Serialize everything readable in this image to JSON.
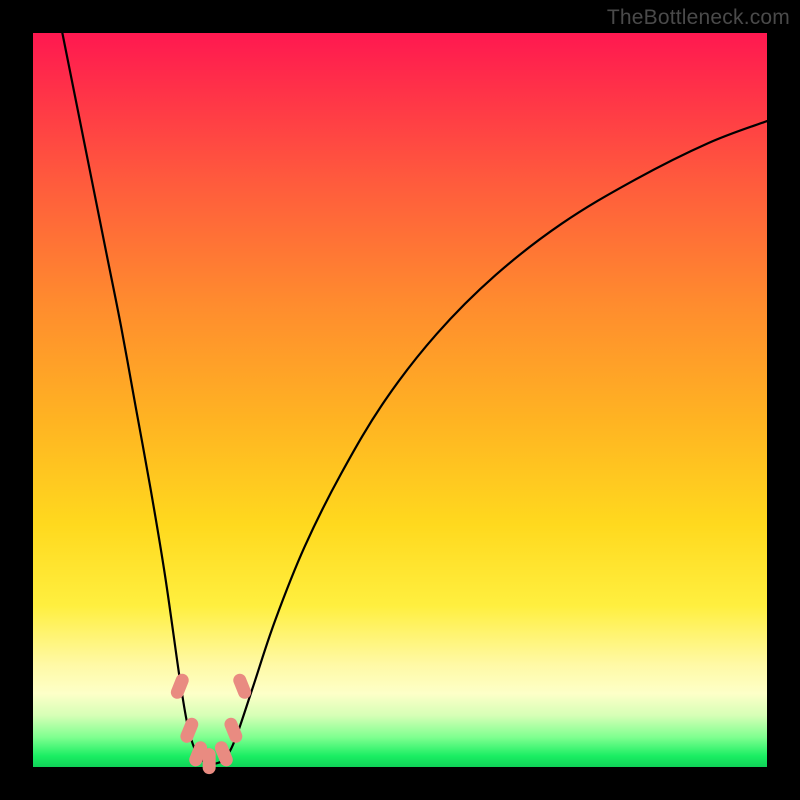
{
  "watermark": "TheBottleneck.com",
  "chart_data": {
    "type": "line",
    "title": "",
    "xlabel": "",
    "ylabel": "",
    "xlim": [
      0,
      100
    ],
    "ylim": [
      0,
      100
    ],
    "series": [
      {
        "name": "bottleneck-curve",
        "x": [
          4,
          6,
          8,
          10,
          12,
          14,
          16,
          18,
          20,
          21,
          22,
          23,
          24,
          25,
          26,
          27,
          28,
          30,
          33,
          37,
          42,
          48,
          55,
          63,
          72,
          82,
          92,
          100
        ],
        "values": [
          100,
          90,
          80,
          70,
          60,
          49,
          38,
          26,
          12,
          6,
          2.5,
          1,
          0.5,
          0.5,
          1,
          2.5,
          5,
          11,
          20,
          30,
          40,
          50,
          59,
          67,
          74,
          80,
          85,
          88
        ]
      }
    ],
    "markers": {
      "name": "highlight-dots",
      "color": "#e98b81",
      "points": [
        {
          "x": 20.0,
          "y": 11
        },
        {
          "x": 21.3,
          "y": 5
        },
        {
          "x": 22.5,
          "y": 1.8
        },
        {
          "x": 24.0,
          "y": 0.8
        },
        {
          "x": 26.0,
          "y": 1.8
        },
        {
          "x": 27.3,
          "y": 5
        },
        {
          "x": 28.5,
          "y": 11
        }
      ]
    },
    "gradient_stops": [
      {
        "pos": 0.0,
        "color": "#ff1850"
      },
      {
        "pos": 0.07,
        "color": "#ff2f49"
      },
      {
        "pos": 0.2,
        "color": "#ff5a3d"
      },
      {
        "pos": 0.37,
        "color": "#ff8c2e"
      },
      {
        "pos": 0.53,
        "color": "#ffb422"
      },
      {
        "pos": 0.67,
        "color": "#ffd91e"
      },
      {
        "pos": 0.78,
        "color": "#ffef3f"
      },
      {
        "pos": 0.86,
        "color": "#fff9a5"
      },
      {
        "pos": 0.9,
        "color": "#fdffc8"
      },
      {
        "pos": 0.93,
        "color": "#d6ffb6"
      },
      {
        "pos": 0.96,
        "color": "#7dff8f"
      },
      {
        "pos": 0.985,
        "color": "#1bee63"
      },
      {
        "pos": 1.0,
        "color": "#0fd258"
      }
    ]
  }
}
